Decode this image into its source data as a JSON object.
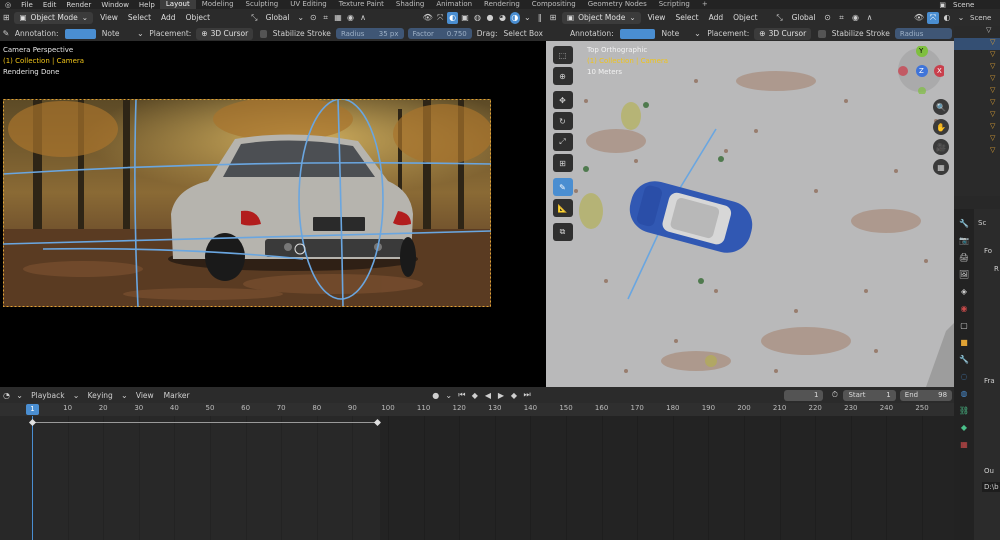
{
  "menubar": {
    "menus": [
      "File",
      "Edit",
      "Render",
      "Window",
      "Help"
    ],
    "workspaces": [
      "Layout",
      "Modeling",
      "Sculpting",
      "UV Editing",
      "Texture Paint",
      "Shading",
      "Animation",
      "Rendering",
      "Compositing",
      "Geometry Nodes",
      "Scripting",
      "+"
    ],
    "scene_label": "Scene"
  },
  "left_header": {
    "mode": "Object Mode",
    "menus": [
      "View",
      "Select",
      "Add",
      "Object"
    ],
    "transform": "Global"
  },
  "left_tool": {
    "annotation_label": "Annotation:",
    "note": "Note",
    "placement_label": "Placement:",
    "placement_value": "3D Cursor",
    "stabilize": "Stabilize Stroke",
    "radius_label": "Radius",
    "radius_value": "35 px",
    "factor_label": "Factor",
    "factor_value": "0.750",
    "drag_label": "Drag:",
    "drag_value": "Select Box"
  },
  "left_overlay": {
    "line1": "Camera Perspective",
    "line2": "(1) Collection | Camera",
    "line3": "Rendering Done"
  },
  "right_header": {
    "mode": "Object Mode",
    "menus": [
      "View",
      "Select",
      "Add",
      "Object"
    ],
    "transform": "Global"
  },
  "right_tool": {
    "annotation_label": "Annotation:",
    "note": "Note",
    "placement_label": "Placement:",
    "placement_value": "3D Cursor",
    "stabilize": "Stabilize Stroke",
    "radius_label": "Radius"
  },
  "right_overlay": {
    "line1": "Top Orthographic",
    "line2": "(1) Collection | Camera",
    "line3": "10 Meters"
  },
  "gizmo": {
    "y": "Y",
    "z": "Z",
    "x": "X"
  },
  "timeline": {
    "menus": [
      "Playback",
      "Keying",
      "View",
      "Marker"
    ],
    "current_frame": "1",
    "start_label": "Start",
    "start_value": "1",
    "end_label": "End",
    "end_value": "98",
    "ruler_marks": [
      "10",
      "20",
      "30",
      "40",
      "50",
      "60",
      "70",
      "80",
      "90",
      "100",
      "110",
      "120",
      "130",
      "140",
      "150",
      "160",
      "170",
      "180",
      "190",
      "200",
      "210",
      "220",
      "230",
      "240",
      "250"
    ],
    "frame_indicator": "1"
  },
  "right_panel": {
    "scene_text": "Scene",
    "sc_text": "Sc",
    "for_text": "Fo",
    "r_text": "R",
    "fra_text": "Fra",
    "out_text": "Ou",
    "path_text": "D:\\b"
  },
  "colors": {
    "accent": "#4a8ed1",
    "overlay_yellow": "#f0c419",
    "gizmo_x": "#c93f4c",
    "gizmo_y": "#7fbf3f",
    "gizmo_z": "#3f74d9"
  }
}
